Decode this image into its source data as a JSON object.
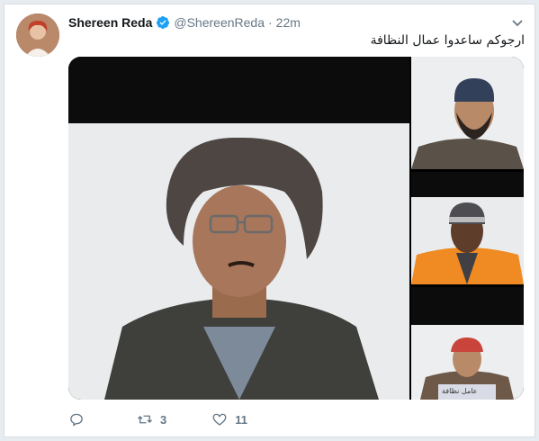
{
  "tweet": {
    "author_name": "Shereen Reda",
    "handle": "@ShereenReda",
    "separator": "·",
    "time": "22m",
    "verified": true,
    "text": "ارجوكم ساعدوا عمال النظافة",
    "media": {
      "count": 4,
      "sign_text": "عامل نظافة"
    },
    "actions": {
      "reply_count": "",
      "retweet_count": "3",
      "like_count": "11"
    }
  },
  "colors": {
    "verified_blue": "#1da1f2",
    "muted_text": "#657786",
    "orange_vest": "#f08b23"
  },
  "icons": [
    "verified-badge-icon",
    "chevron-down-icon",
    "reply-icon",
    "retweet-icon",
    "like-icon"
  ]
}
